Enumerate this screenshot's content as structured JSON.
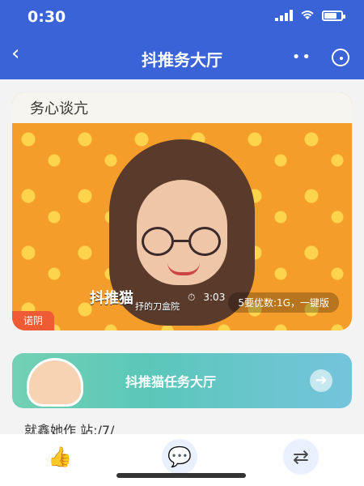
{
  "status": {
    "time": "0:30",
    "icons": [
      "signal-bars-icon",
      "wifi-icon",
      "battery-icon"
    ],
    "battery_level": 0.75
  },
  "nav": {
    "title": "抖推务大厅",
    "back_icon": "chevron-left-icon",
    "more_icon": "more-dots-icon",
    "target_icon": "target-icon"
  },
  "content": {
    "card": {
      "top_label": "务心谈亢",
      "logo_title": "抖推猫",
      "logo_subtitle": "抒的刀盒院",
      "time_text": "3:03",
      "pill_text": "5要优数:1G，一键版",
      "badge_text": "诺阴"
    },
    "banner": {
      "text": "抖推猫任务大厅"
    },
    "partial_text": "就鑫她作 站:/7/"
  },
  "colors": {
    "header_blue": "#3a63d8",
    "card_orange": "#f59d2a",
    "pattern_yellow": "#fdd44b",
    "banner_teal": "#5bc7b9"
  },
  "bottom": {
    "like_icon": "thumbs-up-icon",
    "message_icon": "chat-bubble-icon",
    "swap_icon": "swap-arrows-icon"
  }
}
